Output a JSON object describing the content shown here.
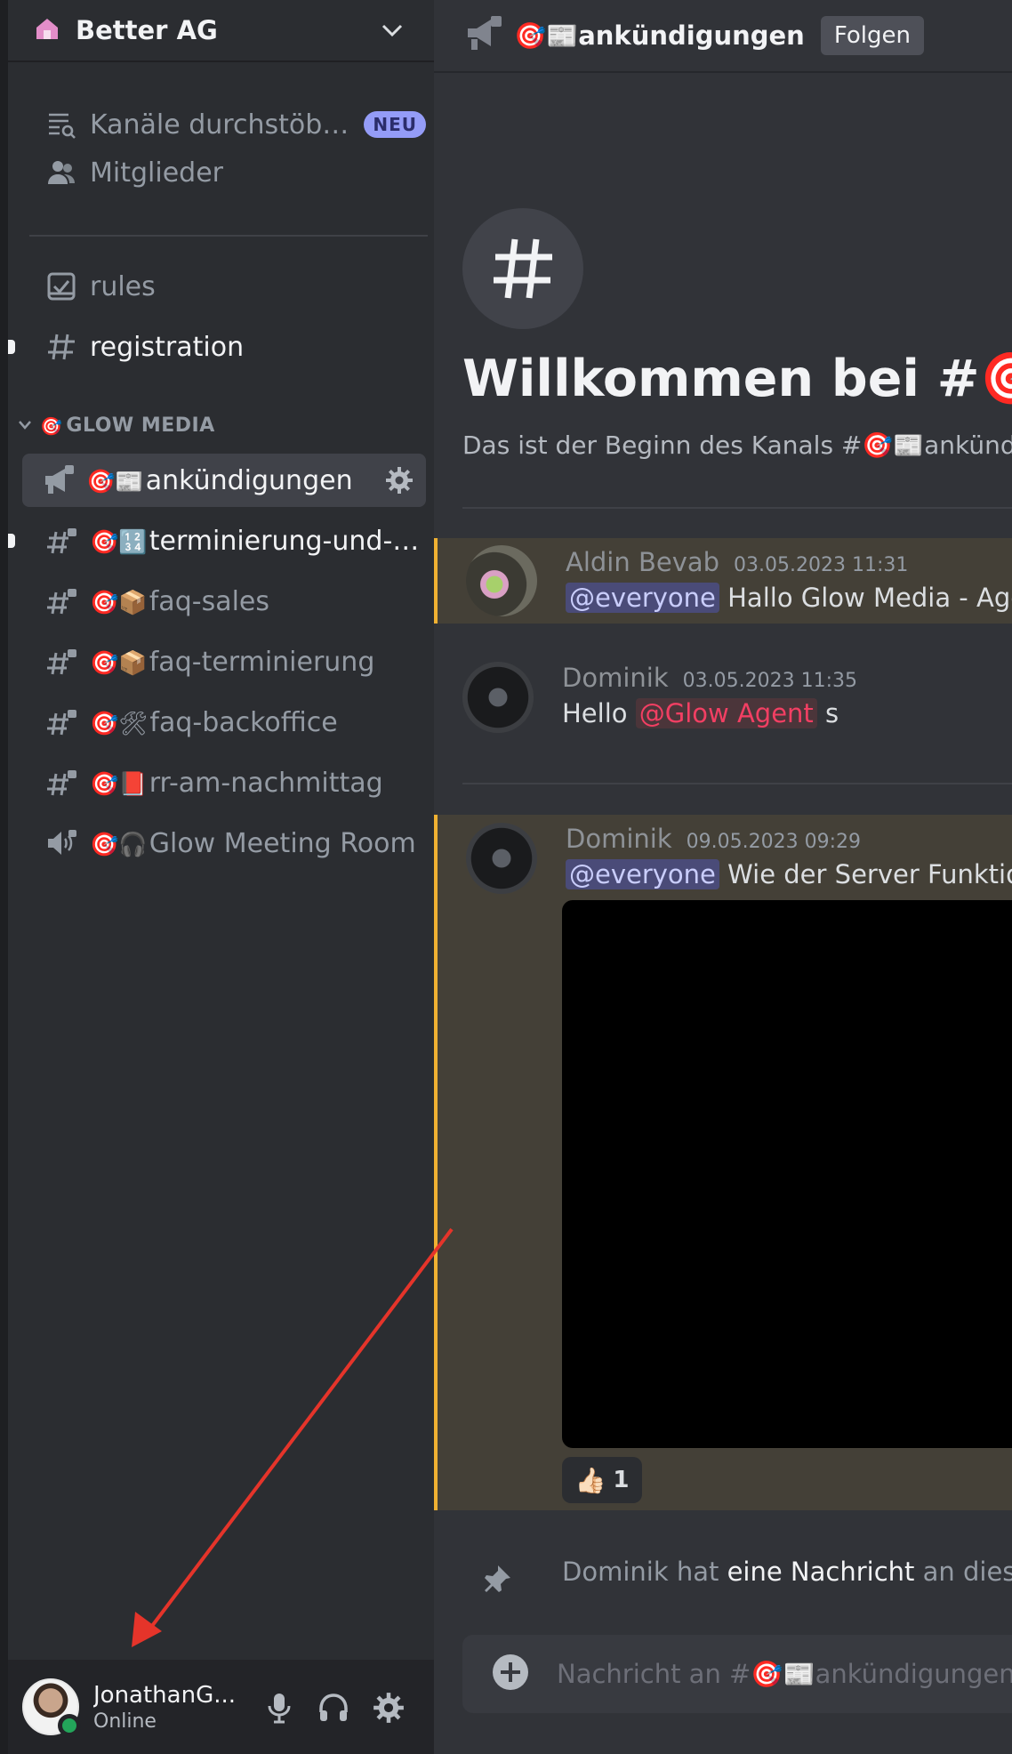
{
  "server": {
    "name": "Better AG"
  },
  "nav": {
    "browse_label": "Kanäle durchstöbern",
    "browse_badge": "NEU",
    "members_label": "Mitglieder"
  },
  "channels_top": [
    {
      "label": "rules",
      "icon": "rules-icon"
    },
    {
      "label": "registration",
      "icon": "hash-icon"
    }
  ],
  "category": {
    "label": "GLOW MEDIA",
    "emoji": "🎯"
  },
  "channels": [
    {
      "emoji": "🎯📰",
      "label": "ankündigungen",
      "icon": "megaphone-icon",
      "active": true
    },
    {
      "emoji": "🎯🔢",
      "label": "terminierung-und-s...",
      "icon": "hash-lock-icon",
      "unread": true
    },
    {
      "emoji": "🎯📦",
      "label": "faq-sales",
      "icon": "hash-lock-icon"
    },
    {
      "emoji": "🎯📦",
      "label": "faq-terminierung",
      "icon": "hash-lock-icon"
    },
    {
      "emoji": "🎯🛠",
      "label": "faq-backoffice",
      "icon": "hash-lock-icon"
    },
    {
      "emoji": "🎯📕",
      "label": "rr-am-nachmittag",
      "icon": "hash-lock-icon"
    },
    {
      "emoji": "🎯🎧",
      "label": "Glow Meeting Room",
      "icon": "speaker-lock-icon"
    }
  ],
  "user": {
    "name": "JonathanG...",
    "status": "Online"
  },
  "header": {
    "channel_emoji": "🎯📰",
    "channel": "ankündigungen",
    "follow_label": "Folgen"
  },
  "welcome": {
    "title": "Willkommen bei #🎯📰",
    "subtitle": "Das ist der Beginn des Kanals #🎯📰ankündigu"
  },
  "messages": [
    {
      "author": "Aldin Bevab",
      "time": "03.05.2023 11:31",
      "mention": "@everyone",
      "text": " Hallo Glow Media - Agen"
    },
    {
      "author": "Dominik",
      "time": "03.05.2023 11:35",
      "prefix": "Hello ",
      "mention": "@Glow Agent",
      "text": " s"
    },
    {
      "author": "Dominik",
      "time": "09.05.2023 09:29",
      "mention": "@everyone",
      "text": " Wie der Server Funktionie"
    }
  ],
  "reaction": {
    "emoji": "👍🏻",
    "count": "1"
  },
  "system": {
    "author": "Dominik",
    "middle": " hat ",
    "bold": "eine Nachricht",
    "rest": " an diesen"
  },
  "composer": {
    "placeholder": "Nachricht an #🎯📰ankündigungen"
  },
  "colors": {
    "annotation_arrow": "#e5342a",
    "status_online": "#23a55a",
    "highlight_border": "#f0b132"
  }
}
